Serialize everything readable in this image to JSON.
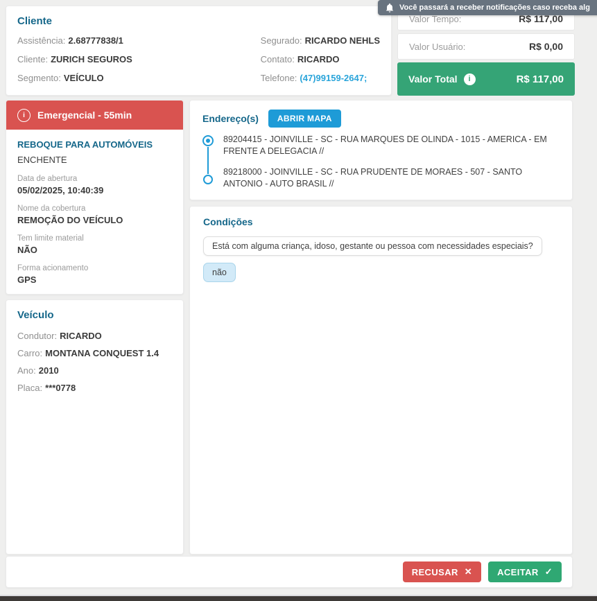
{
  "toast": {
    "text": "Você passará a receber notificações caso receba alg",
    "icon": "bell-icon"
  },
  "cliente": {
    "title": "Cliente",
    "fields_left": [
      {
        "label": "Assistência:",
        "value": "2.68777838/1"
      },
      {
        "label": "Cliente:",
        "value": "ZURICH SEGUROS"
      },
      {
        "label": "Segmento:",
        "value": "VEÍCULO"
      }
    ],
    "fields_right": [
      {
        "label": "Segurado:",
        "value": "RICARDO NEHLS"
      },
      {
        "label": "Contato:",
        "value": "RICARDO"
      },
      {
        "label": "Telefone:",
        "value": "(47)99159-2647;"
      }
    ]
  },
  "valores": {
    "rows": [
      {
        "label": "Valor Tempo:",
        "value": "R$ 117,00"
      },
      {
        "label": "Valor Usuário:",
        "value": "R$ 0,00"
      }
    ],
    "total": {
      "label": "Valor Total",
      "value": "R$ 117,00"
    }
  },
  "servico": {
    "header": "Emergencial - 55min",
    "titulo": "REBOQUE PARA AUTOMÓVEIS",
    "subtitulo": "ENCHENTE",
    "detalhes": [
      {
        "label": "Data de abertura",
        "value": "05/02/2025, 10:40:39"
      },
      {
        "label": "Nome da cobertura",
        "value": "REMOÇÃO DO VEÍCULO"
      },
      {
        "label": "Tem limite material",
        "value": "NÃO"
      },
      {
        "label": "Forma acionamento",
        "value": "GPS"
      }
    ]
  },
  "veiculo": {
    "title": "Veículo",
    "fields": [
      {
        "label": "Condutor:",
        "value": "RICARDO"
      },
      {
        "label": "Carro:",
        "value": "MONTANA CONQUEST 1.4"
      },
      {
        "label": "Ano:",
        "value": "2010"
      },
      {
        "label": "Placa:",
        "value": "***0778"
      }
    ]
  },
  "enderecos": {
    "title": "Endereço(s)",
    "abrir_mapa_label": "ABRIR MAPA",
    "items": [
      "89204415 - JOINVILLE - SC - RUA MARQUES DE OLINDA - 1015 - AMERICA - EM FRENTE A DELEGACIA //",
      "89218000 - JOINVILLE - SC - RUA PRUDENTE DE MORAES - 507 - SANTO ANTONIO - AUTO BRASIL //"
    ]
  },
  "condicoes": {
    "title": "Condições",
    "pergunta": "Está com alguma criança, idoso, gestante ou pessoa com necessidades especiais?",
    "resposta": "não"
  },
  "acoes": {
    "recusar": "RECUSAR",
    "aceitar": "ACEITAR"
  },
  "icons": {
    "info_glyph": "i",
    "recusar_glyph": "✕",
    "aceitar_glyph": "✓"
  },
  "colors": {
    "accent_blue": "#1e9bd7",
    "heading_blue": "#15678a",
    "danger_red": "#d95350",
    "success_green": "#35a476",
    "toast_gray": "#68737f"
  }
}
